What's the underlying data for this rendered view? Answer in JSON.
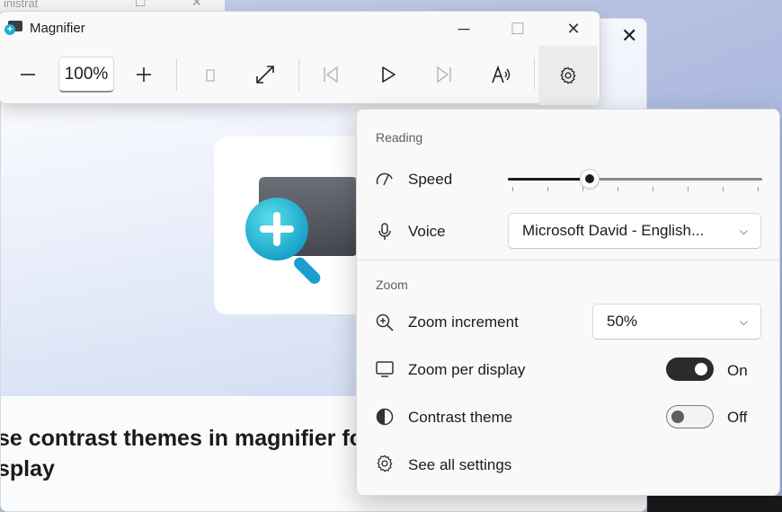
{
  "background_window": {
    "faded_title": "inistrat",
    "close_glyph": "✕",
    "article_title": "se contrast themes in magnifier fo splay",
    "article_title_line1": "se contrast themes in magnifier fo",
    "article_title_line2": "splay",
    "article_sub": "· · · · ·"
  },
  "magnifier": {
    "title": "Magnifier",
    "minimize": "─",
    "maximize": "☐",
    "close": "✕",
    "zoom_out": "−",
    "zoom_level": "100%",
    "zoom_in": "+",
    "fit_icon": "⤢",
    "prev": "⏮",
    "play": "▷",
    "next": "⏭",
    "read_icon": "A",
    "settings_icon": "gear-icon"
  },
  "flyout": {
    "reading": {
      "section_label": "Reading",
      "speed_label": "Speed",
      "speed_value": 0.32,
      "voice_label": "Voice",
      "voice_value": "Microsoft David - English..."
    },
    "zoom": {
      "section_label": "Zoom",
      "increment_label": "Zoom increment",
      "increment_value": "50%",
      "per_display_label": "Zoom per display",
      "per_display_state": "On",
      "contrast_label": "Contrast theme",
      "contrast_state": "Off"
    },
    "see_all": "See all settings"
  }
}
